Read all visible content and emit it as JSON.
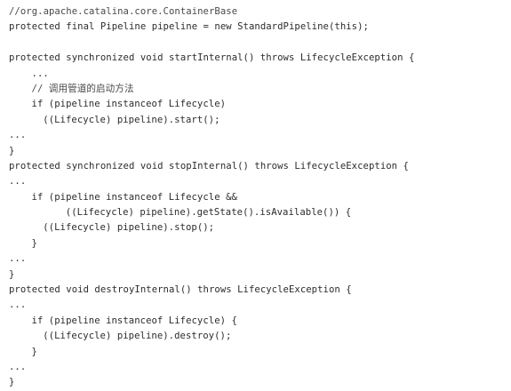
{
  "code_lines": [
    {
      "text": "//org.apache.catalina.core.ContainerBase",
      "indent": 0
    },
    {
      "text": "protected final Pipeline pipeline = new StandardPipeline(this);",
      "indent": 0
    },
    {
      "text": "",
      "indent": 0
    },
    {
      "text": "protected synchronized void startInternal() throws LifecycleException {",
      "indent": 0
    },
    {
      "text": "...",
      "indent": 4
    },
    {
      "text": "// 调用管道的启动方法",
      "indent": 4
    },
    {
      "text": "if (pipeline instanceof Lifecycle)",
      "indent": 4
    },
    {
      "text": "((Lifecycle) pipeline).start();",
      "indent": 6
    },
    {
      "text": "...",
      "indent": 0
    },
    {
      "text": "}",
      "indent": 0
    },
    {
      "text": "protected synchronized void stopInternal() throws LifecycleException {",
      "indent": 0
    },
    {
      "text": "...",
      "indent": 0
    },
    {
      "text": "if (pipeline instanceof Lifecycle &&",
      "indent": 4
    },
    {
      "text": "((Lifecycle) pipeline).getState().isAvailable()) {",
      "indent": 10
    },
    {
      "text": "((Lifecycle) pipeline).stop();",
      "indent": 6
    },
    {
      "text": "}",
      "indent": 4
    },
    {
      "text": "...",
      "indent": 0
    },
    {
      "text": "}",
      "indent": 0
    },
    {
      "text": "protected void destroyInternal() throws LifecycleException {",
      "indent": 0
    },
    {
      "text": "...",
      "indent": 0
    },
    {
      "text": "if (pipeline instanceof Lifecycle) {",
      "indent": 4
    },
    {
      "text": "((Lifecycle) pipeline).destroy();",
      "indent": 6
    },
    {
      "text": "}",
      "indent": 4
    },
    {
      "text": "...",
      "indent": 0
    },
    {
      "text": "}",
      "indent": 0
    }
  ]
}
